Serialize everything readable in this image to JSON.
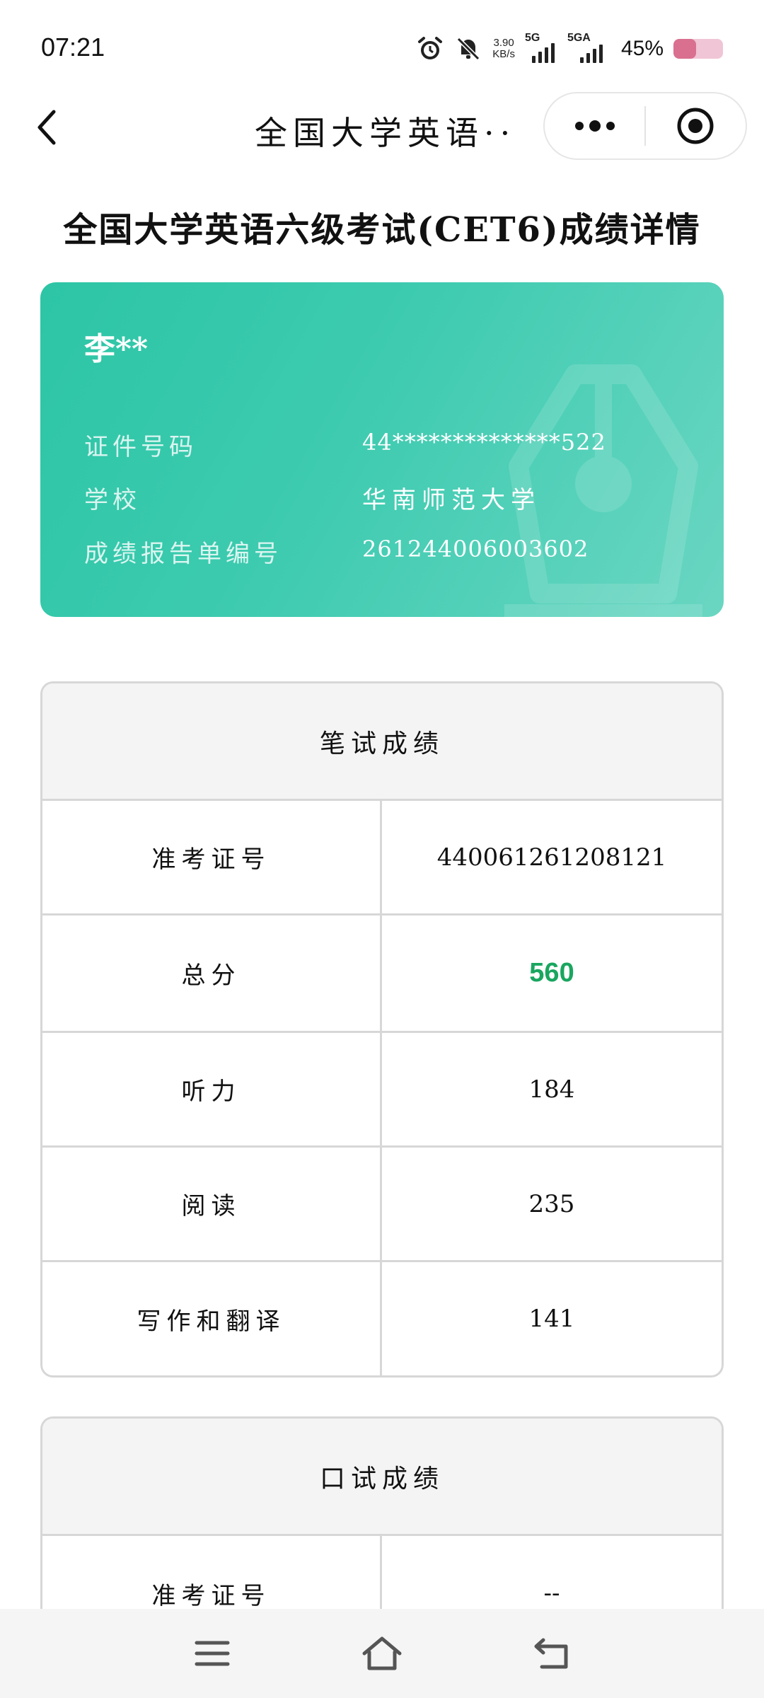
{
  "status_bar": {
    "time": "07:21",
    "net_speed_value": "3.90",
    "net_speed_unit": "KB/s",
    "sim1_label": "5G",
    "sim2_label": "5GA",
    "battery_percent": "45%",
    "battery_level": 0.45,
    "icons": [
      "alarm-icon",
      "mute-bell-icon"
    ]
  },
  "nav": {
    "title": "全国大学英语···"
  },
  "page_title": "全国大学英语六级考试(CET6)成绩详情",
  "card": {
    "name": "李**",
    "rows": [
      {
        "label": "证件号码",
        "value": "44**************522"
      },
      {
        "label": "学校",
        "value": "华南师范大学"
      },
      {
        "label": "成绩报告单编号",
        "value": "261244006003602"
      }
    ]
  },
  "written": {
    "heading": "笔试成绩",
    "rows": [
      {
        "label": "准考证号",
        "value": "440061261208121"
      },
      {
        "label": "总分",
        "value": "560"
      },
      {
        "label": "听力",
        "value": "184"
      },
      {
        "label": "阅读",
        "value": "235"
      },
      {
        "label": "写作和翻译",
        "value": "141"
      }
    ]
  },
  "oral": {
    "heading": "口试成绩",
    "rows": [
      {
        "label": "准考证号",
        "value": "--"
      }
    ]
  },
  "colors": {
    "card_gradient_start": "#2cc5a5",
    "card_gradient_end": "#6ad6c2",
    "total_score": "#1aa660"
  }
}
